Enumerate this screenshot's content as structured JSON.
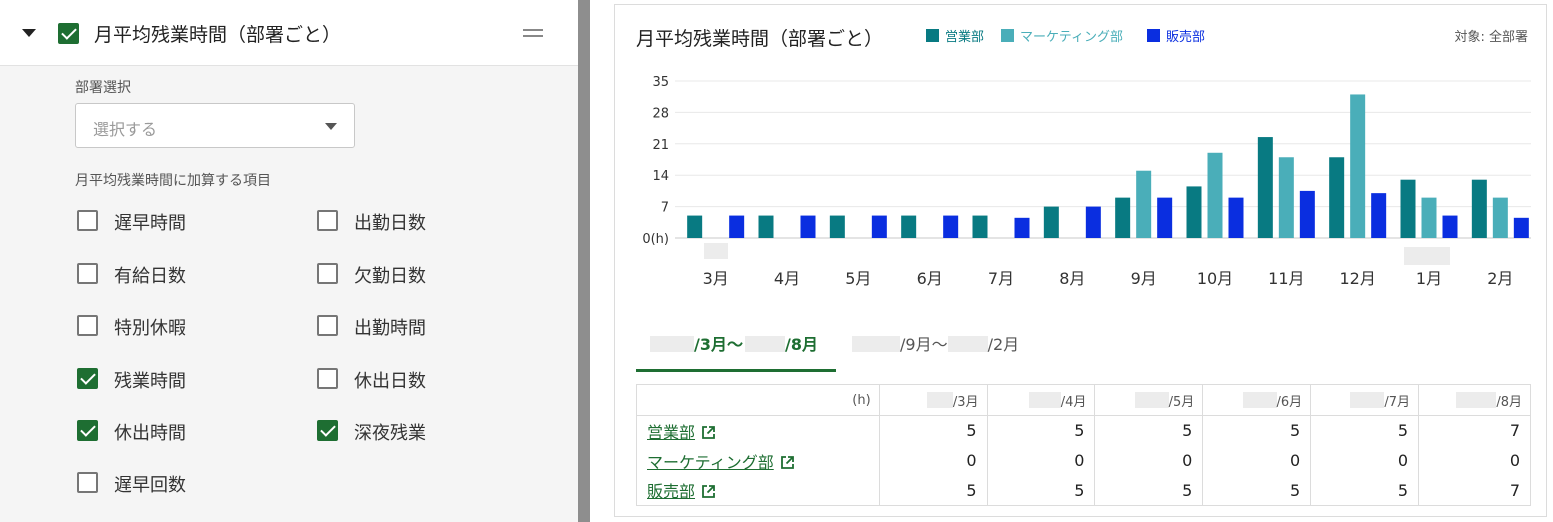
{
  "left_panel": {
    "title": "月平均残業時間（部署ごと）",
    "title_checked": true,
    "dept_select_label": "部署選択",
    "dept_select_placeholder": "選択する",
    "items_label": "月平均残業時間に加算する項目",
    "options": [
      {
        "label": "遅早時間",
        "checked": false
      },
      {
        "label": "出勤日数",
        "checked": false
      },
      {
        "label": "有給日数",
        "checked": false
      },
      {
        "label": "欠勤日数",
        "checked": false
      },
      {
        "label": "特別休暇",
        "checked": false
      },
      {
        "label": "出勤時間",
        "checked": false
      },
      {
        "label": "残業時間",
        "checked": true
      },
      {
        "label": "休出日数",
        "checked": false
      },
      {
        "label": "休出時間",
        "checked": true
      },
      {
        "label": "深夜残業",
        "checked": true
      },
      {
        "label": "遅早回数",
        "checked": false
      }
    ]
  },
  "card": {
    "title": "月平均残業時間（部署ごと）",
    "target": "対象: 全部署",
    "legend": [
      {
        "name": "営業部",
        "color": "#087a82"
      },
      {
        "name": "マーケティング部",
        "color": "#4aaeb9"
      },
      {
        "name": "販売部",
        "color": "#0a2ee0"
      }
    ],
    "tabs": [
      {
        "start": "/3月～",
        "end": "/8月",
        "active": true
      },
      {
        "start": "/9月～",
        "end": "/2月",
        "active": false
      }
    ],
    "table": {
      "unit": "(h)",
      "columns": [
        "/3月",
        "/4月",
        "/5月",
        "/6月",
        "/7月",
        "/8月"
      ],
      "rows": [
        {
          "dept": "営業部",
          "values": [
            "5",
            "5",
            "5",
            "5",
            "5",
            "7"
          ]
        },
        {
          "dept": "マーケティング部",
          "values": [
            "0",
            "0",
            "0",
            "0",
            "0",
            "0"
          ]
        },
        {
          "dept": "販売部",
          "values": [
            "5",
            "5",
            "5",
            "5",
            "5",
            "7"
          ]
        }
      ]
    }
  },
  "chart_data": {
    "type": "bar",
    "categories": [
      "3月",
      "4月",
      "5月",
      "6月",
      "7月",
      "8月",
      "9月",
      "10月",
      "11月",
      "12月",
      "1月",
      "2月"
    ],
    "series": [
      {
        "name": "営業部",
        "values": [
          5,
          5,
          5,
          5,
          5,
          7,
          9,
          11.5,
          22.5,
          18,
          13,
          13
        ]
      },
      {
        "name": "マーケティング部",
        "values": [
          0,
          0,
          0,
          0,
          0,
          0,
          15,
          19,
          18,
          32,
          9,
          9
        ]
      },
      {
        "name": "販売部",
        "values": [
          5,
          5,
          5,
          5,
          4.5,
          7,
          9,
          9,
          10.5,
          10,
          5,
          4.5
        ]
      }
    ],
    "y_ticks": [
      "0(h)",
      "7",
      "14",
      "21",
      "28",
      "35"
    ],
    "ylim": [
      0,
      35
    ],
    "grid": true,
    "legend": "top"
  }
}
